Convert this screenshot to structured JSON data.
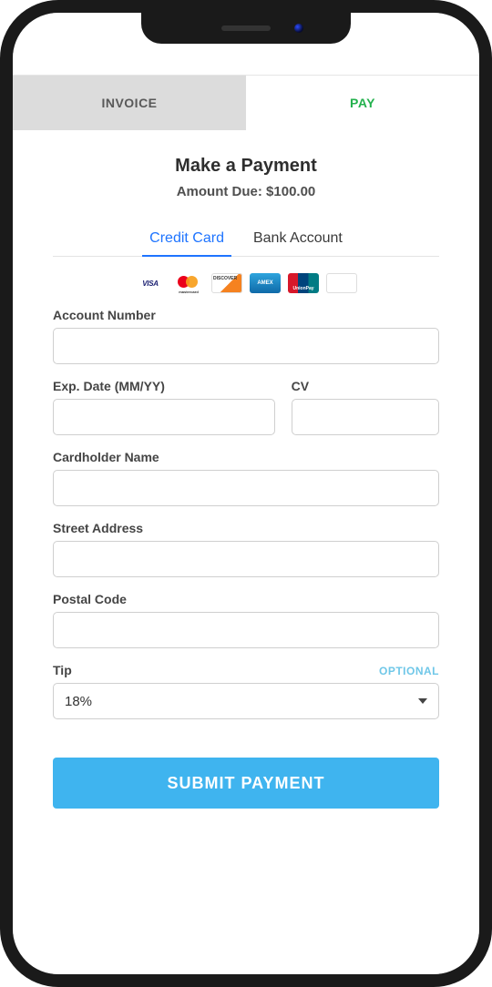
{
  "pageTabs": {
    "invoice": "INVOICE",
    "pay": "PAY"
  },
  "header": {
    "title": "Make a Payment",
    "amountDue": "Amount Due: $100.00"
  },
  "methodTabs": {
    "creditCard": "Credit Card",
    "bankAccount": "Bank Account"
  },
  "cardBrands": {
    "visa": "VISA",
    "discover": "DISCOVER",
    "amex": "AMEX",
    "unionpay": "UnionPay"
  },
  "form": {
    "accountNumber": {
      "label": "Account Number",
      "value": ""
    },
    "expDate": {
      "label": "Exp. Date (MM/YY)",
      "value": ""
    },
    "cv": {
      "label": "CV",
      "value": ""
    },
    "cardholder": {
      "label": "Cardholder Name",
      "value": ""
    },
    "street": {
      "label": "Street Address",
      "value": ""
    },
    "postal": {
      "label": "Postal Code",
      "value": ""
    },
    "tip": {
      "label": "Tip",
      "optional": "OPTIONAL",
      "selected": "18%"
    }
  },
  "submit": "SUBMIT PAYMENT"
}
